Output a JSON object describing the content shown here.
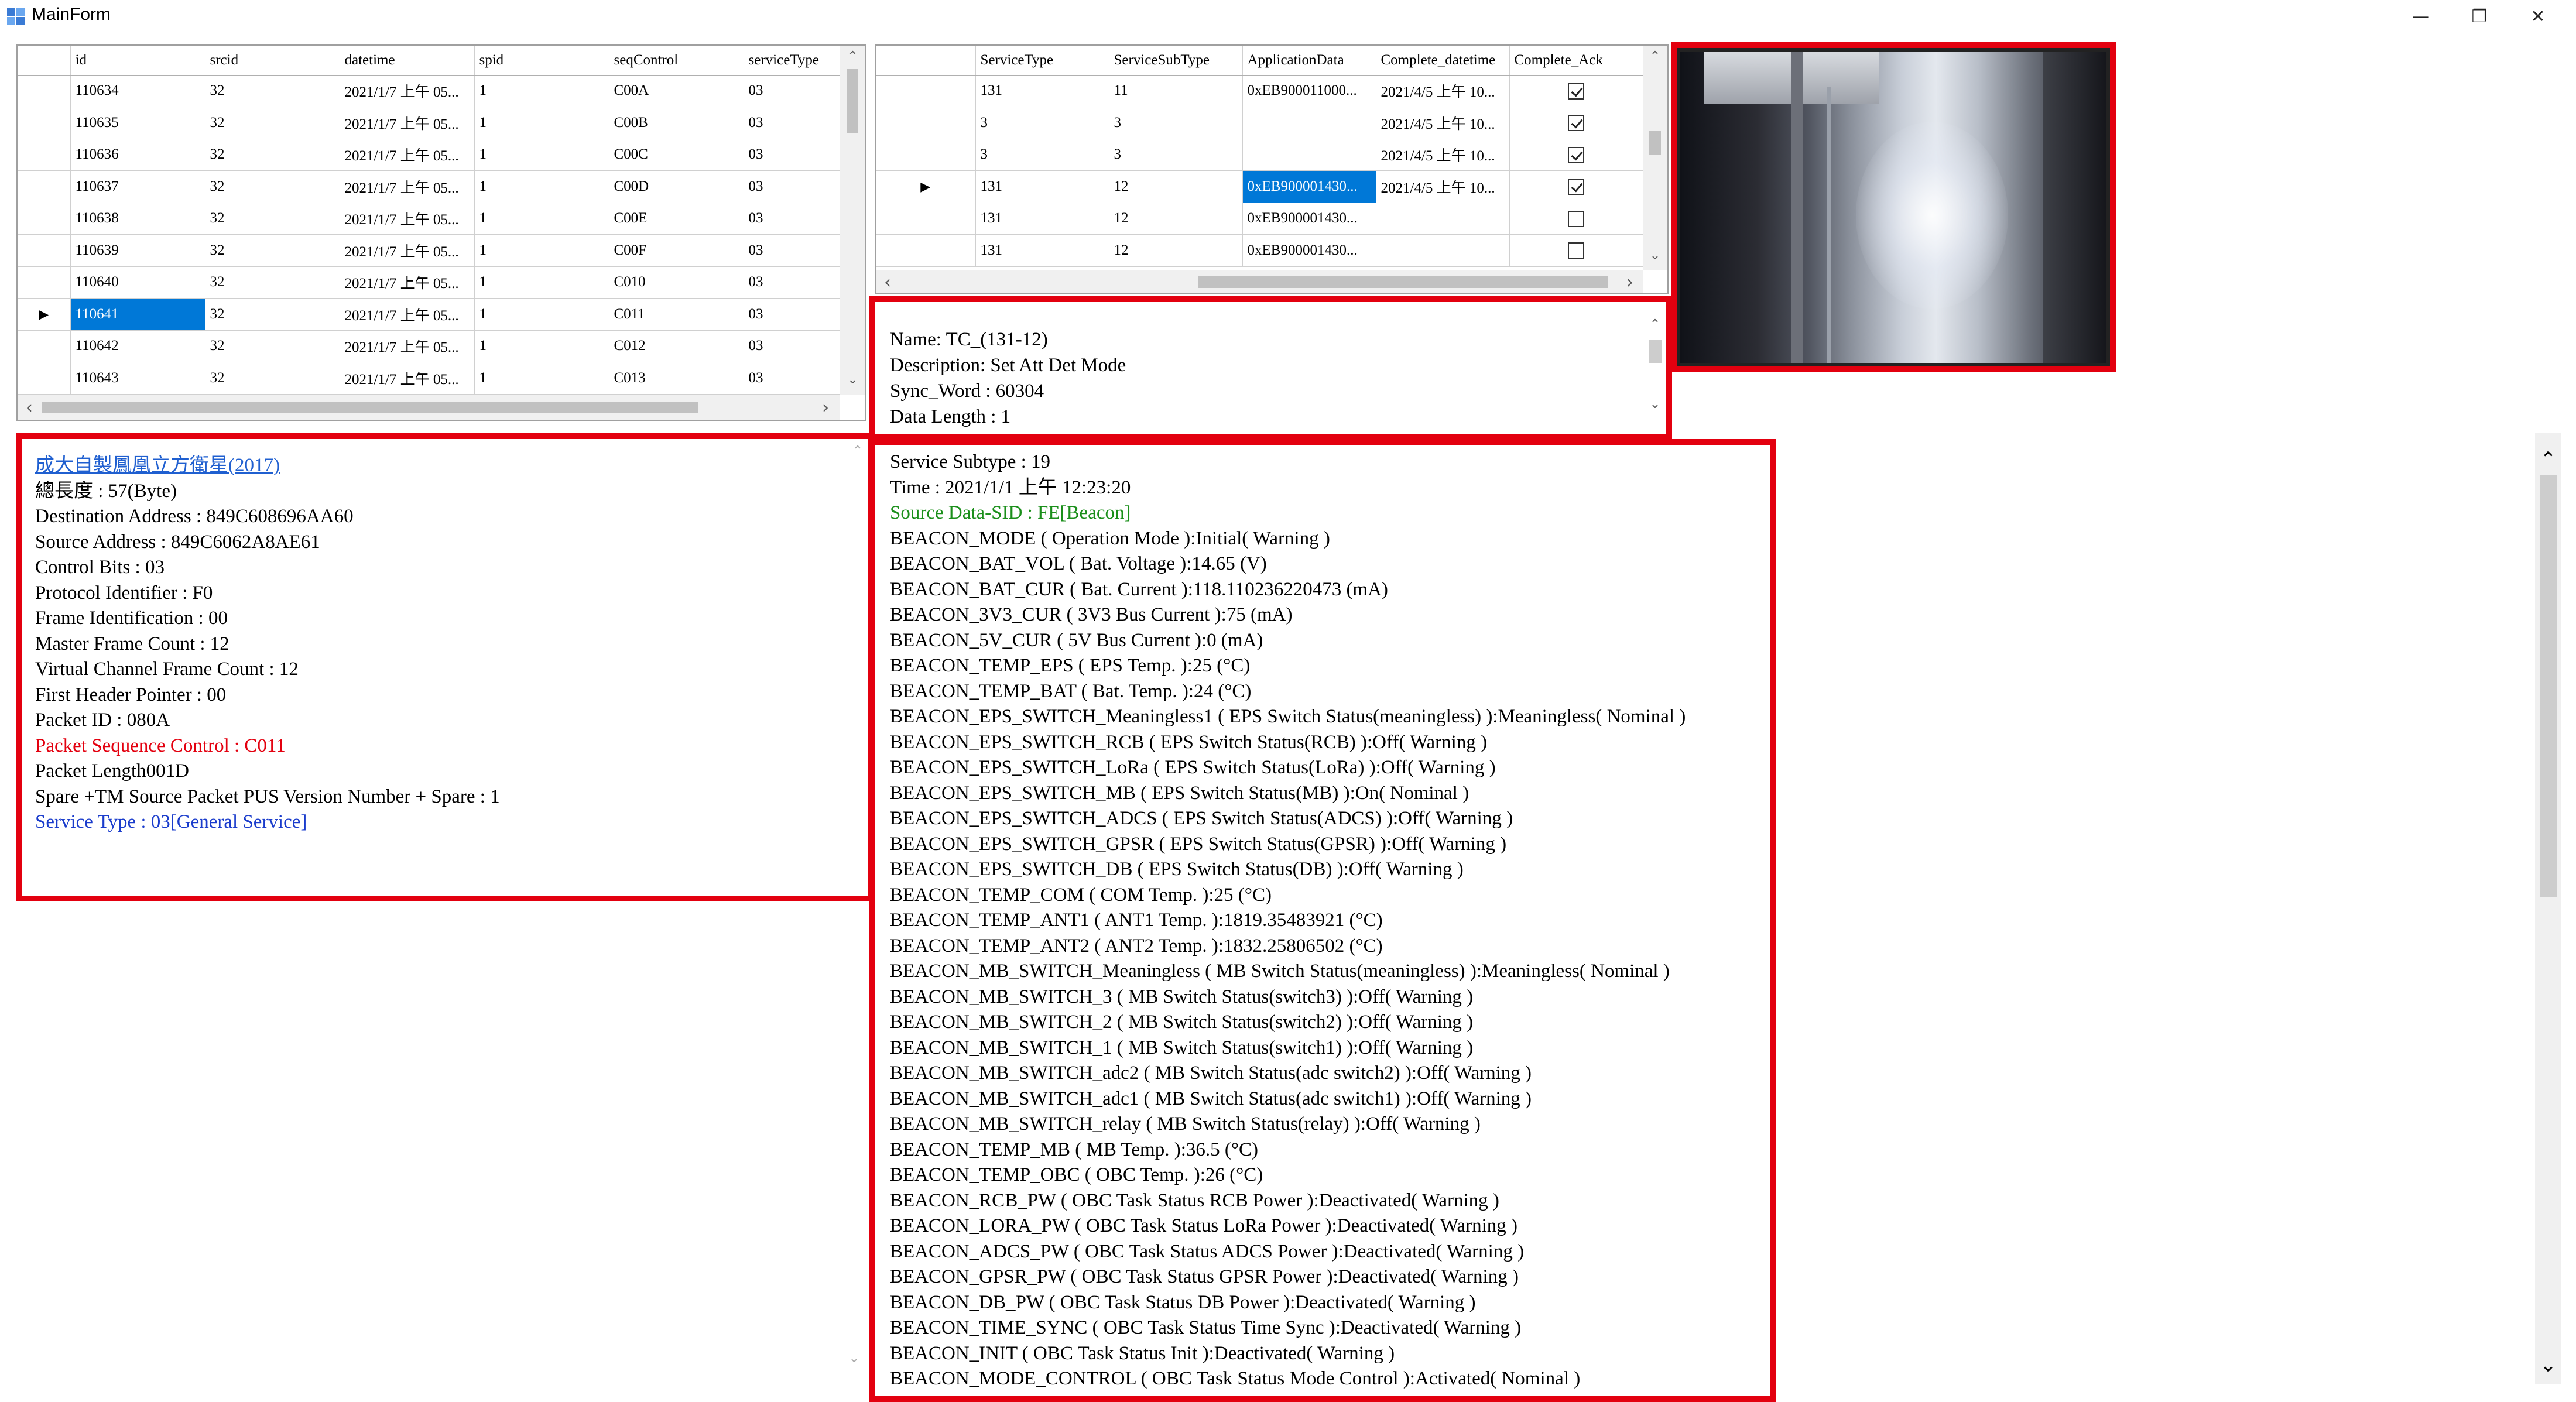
{
  "window": {
    "title": "MainForm",
    "minimize_glyph": "—",
    "maximize_glyph": "❐",
    "close_glyph": "✕"
  },
  "packet_grid": {
    "columns": [
      "id",
      "srcid",
      "datetime",
      "spid",
      "seqControl",
      "serviceType"
    ],
    "rows": [
      [
        "110634",
        "32",
        "2021/1/7 上午 05...",
        "1",
        "C00A",
        "03"
      ],
      [
        "110635",
        "32",
        "2021/1/7 上午 05...",
        "1",
        "C00B",
        "03"
      ],
      [
        "110636",
        "32",
        "2021/1/7 上午 05...",
        "1",
        "C00C",
        "03"
      ],
      [
        "110637",
        "32",
        "2021/1/7 上午 05...",
        "1",
        "C00D",
        "03"
      ],
      [
        "110638",
        "32",
        "2021/1/7 上午 05...",
        "1",
        "C00E",
        "03"
      ],
      [
        "110639",
        "32",
        "2021/1/7 上午 05...",
        "1",
        "C00F",
        "03"
      ],
      [
        "110640",
        "32",
        "2021/1/7 上午 05...",
        "1",
        "C010",
        "03"
      ],
      [
        "110641",
        "32",
        "2021/1/7 上午 05...",
        "1",
        "C011",
        "03"
      ],
      [
        "110642",
        "32",
        "2021/1/7 上午 05...",
        "1",
        "C012",
        "03"
      ],
      [
        "110643",
        "32",
        "2021/1/7 上午 05...",
        "1",
        "C013",
        "03"
      ]
    ]
  },
  "command_grid": {
    "columns": [
      "ServiceType",
      "ServiceSubType",
      "ApplicationData",
      "Complete_datetime",
      "Complete_Ack"
    ],
    "rows": [
      [
        "131",
        "11",
        "0xEB900011000...",
        "2021/4/5 上午 10...",
        true
      ],
      [
        "3",
        "3",
        "",
        "2021/4/5 上午 10...",
        true
      ],
      [
        "3",
        "3",
        "",
        "2021/4/5 上午 10...",
        true
      ],
      [
        "131",
        "12",
        "0xEB900001430...",
        "2021/4/5 上午 10...",
        true
      ],
      [
        "131",
        "12",
        "0xEB900001430...",
        "",
        false
      ],
      [
        "131",
        "12",
        "0xEB900001430...",
        "",
        false
      ]
    ]
  },
  "command_info": {
    "lines": [
      "Name: TC_(131-12)",
      "Description: Set Att Det Mode",
      "Sync_Word : 60304",
      "Data  Length : 1"
    ]
  },
  "packet_detail": {
    "title_link": "成大自製鳳凰立方衛星(2017)",
    "lines": [
      "總長度 : 57(Byte)",
      "Destination Address : 849C608696AA60",
      "Source Address : 849C6062A8AE61",
      "Control Bits : 03",
      "Protocol Identifier : F0",
      "Frame Identification : 00",
      "Master Frame Count : 12",
      "Virtual Channel Frame Count : 12",
      "First Header Pointer : 00",
      "Packet ID : 080A"
    ],
    "seq_control": "Packet Sequence Control : C011",
    "packet_length": "Packet Length001D",
    "spare": "Spare +TM Source Packet PUS Version Number + Spare : 1",
    "service_type": "Service Type : 03[General Service]"
  },
  "beacon": {
    "service_subtype": "Service Subtype : 19",
    "time": "Time : 2021/1/1 上午 12:23:20",
    "source_sid": "Source Data-SID : FE[Beacon]",
    "lines": [
      "BEACON_MODE ( Operation Mode ):Initial( Warning )",
      "BEACON_BAT_VOL ( Bat. Voltage ):14.65 (V)",
      "BEACON_BAT_CUR ( Bat. Current ):118.110236220473 (mA)",
      "BEACON_3V3_CUR ( 3V3 Bus Current ):75 (mA)",
      "BEACON_5V_CUR ( 5V Bus Current ):0 (mA)",
      "BEACON_TEMP_EPS ( EPS Temp. ):25 (°C)",
      "BEACON_TEMP_BAT ( Bat. Temp. ):24 (°C)",
      "BEACON_EPS_SWITCH_Meaningless1 ( EPS Switch Status(meaningless) ):Meaningless( Nominal )",
      "BEACON_EPS_SWITCH_RCB ( EPS Switch Status(RCB) ):Off( Warning )",
      "BEACON_EPS_SWITCH_LoRa ( EPS Switch Status(LoRa) ):Off( Warning )",
      "BEACON_EPS_SWITCH_MB ( EPS Switch Status(MB) ):On( Nominal )",
      "BEACON_EPS_SWITCH_ADCS ( EPS Switch Status(ADCS) ):Off( Warning )",
      "BEACON_EPS_SWITCH_GPSR ( EPS Switch Status(GPSR) ):Off( Warning )",
      "BEACON_EPS_SWITCH_DB ( EPS Switch Status(DB) ):Off( Warning )",
      "BEACON_TEMP_COM ( COM Temp. ):25 (°C)",
      "BEACON_TEMP_ANT1 ( ANT1 Temp. ):1819.35483921 (°C)",
      "BEACON_TEMP_ANT2 ( ANT2 Temp. ):1832.25806502 (°C)",
      "BEACON_MB_SWITCH_Meaningless ( MB Switch Status(meaningless) ):Meaningless( Nominal )",
      "BEACON_MB_SWITCH_3 ( MB Switch Status(switch3) ):Off( Warning )",
      "BEACON_MB_SWITCH_2 ( MB Switch Status(switch2) ):Off( Warning )",
      "BEACON_MB_SWITCH_1 ( MB Switch Status(switch1) ):Off( Warning )",
      "BEACON_MB_SWITCH_adc2 ( MB Switch Status(adc switch2) ):Off( Warning )",
      "BEACON_MB_SWITCH_adc1 ( MB Switch Status(adc switch1) ):Off( Warning )",
      "BEACON_MB_SWITCH_relay ( MB Switch Status(relay) ):Off( Warning )",
      "BEACON_TEMP_MB ( MB Temp. ):36.5 (°C)",
      "BEACON_TEMP_OBC ( OBC Temp. ):26 (°C)",
      "BEACON_RCB_PW ( OBC Task Status RCB Power ):Deactivated( Warning )",
      "BEACON_LORA_PW ( OBC Task Status LoRa Power ):Deactivated( Warning )",
      "BEACON_ADCS_PW ( OBC Task Status ADCS Power ):Deactivated( Warning )",
      "BEACON_GPSR_PW ( OBC Task Status GPSR Power ):Deactivated( Warning )",
      "BEACON_DB_PW ( OBC Task Status DB Power ):Deactivated( Warning )",
      "BEACON_TIME_SYNC ( OBC Task Status Time Sync ):Deactivated( Warning )",
      "BEACON_INIT ( OBC Task Status Init ):Deactivated( Warning )",
      "BEACON_MODE_CONTROL ( OBC Task Status Mode Control ):Activated( Nominal )"
    ]
  },
  "colors": {
    "highlight_frame": "#e3000f",
    "selection": "#0078d7",
    "link": "#1f5fd0",
    "red_text": "#e3000f",
    "blue_text": "#1a3ccc",
    "green_text": "#1b8f1b"
  },
  "icons": {
    "scroll_up": "⌃",
    "scroll_down": "⌄",
    "scroll_left": "‹",
    "scroll_right": "›",
    "row_pointer": "▶"
  }
}
